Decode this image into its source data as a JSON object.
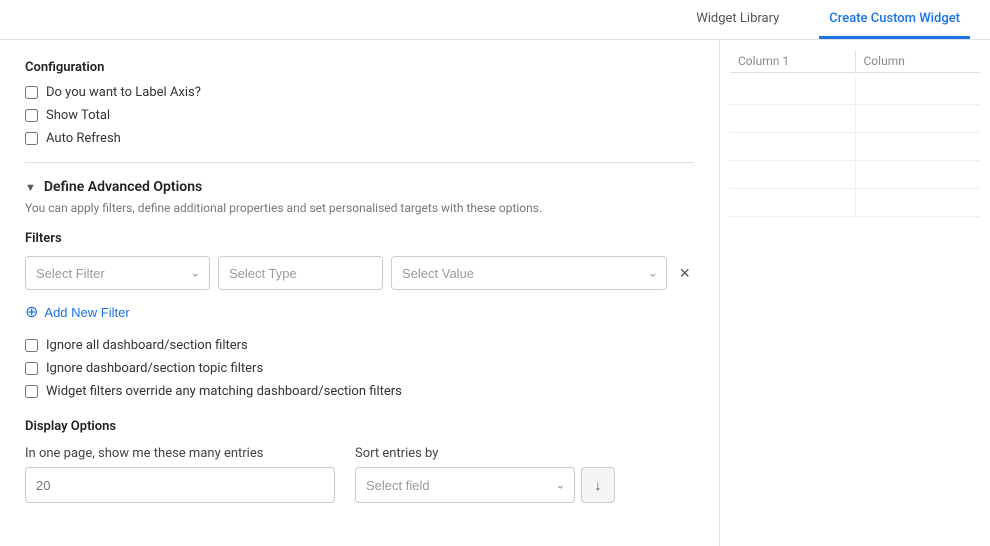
{
  "nav": {
    "tabs": [
      {
        "id": "widget-library",
        "label": "Widget Library",
        "active": false
      },
      {
        "id": "create-custom-widget",
        "label": "Create Custom Widget",
        "active": true
      }
    ]
  },
  "configuration": {
    "title": "Configuration",
    "checkboxes": [
      {
        "id": "label-axis",
        "label": "Do you want to Label Axis?",
        "checked": false
      },
      {
        "id": "show-total",
        "label": "Show Total",
        "checked": false
      },
      {
        "id": "auto-refresh",
        "label": "Auto Refresh",
        "checked": false
      }
    ]
  },
  "advanced": {
    "title": "Define Advanced Options",
    "description": "You can apply filters, define additional properties and set personalised targets with these options."
  },
  "filters": {
    "title": "Filters",
    "selectFilterPlaceholder": "Select Filter",
    "selectTypePlaceholder": "Select Type",
    "selectValuePlaceholder": "Select Value",
    "addNewFilterLabel": "Add New Filter"
  },
  "filterCheckboxes": [
    {
      "id": "ignore-all",
      "label": "Ignore all dashboard/section filters",
      "checked": false
    },
    {
      "id": "ignore-topic",
      "label": "Ignore dashboard/section topic filters",
      "checked": false
    },
    {
      "id": "widget-override",
      "label": "Widget filters override any matching dashboard/section filters",
      "checked": false
    }
  ],
  "displayOptions": {
    "title": "Display Options",
    "entriesLabel": "In one page, show me these many entries",
    "entriesPlaceholder": "20",
    "sortLabel": "Sort entries by",
    "sortPlaceholder": "Select field"
  },
  "rightPanel": {
    "columns": [
      {
        "label": "Column 1"
      },
      {
        "label": "Column"
      }
    ],
    "rows": 5
  }
}
